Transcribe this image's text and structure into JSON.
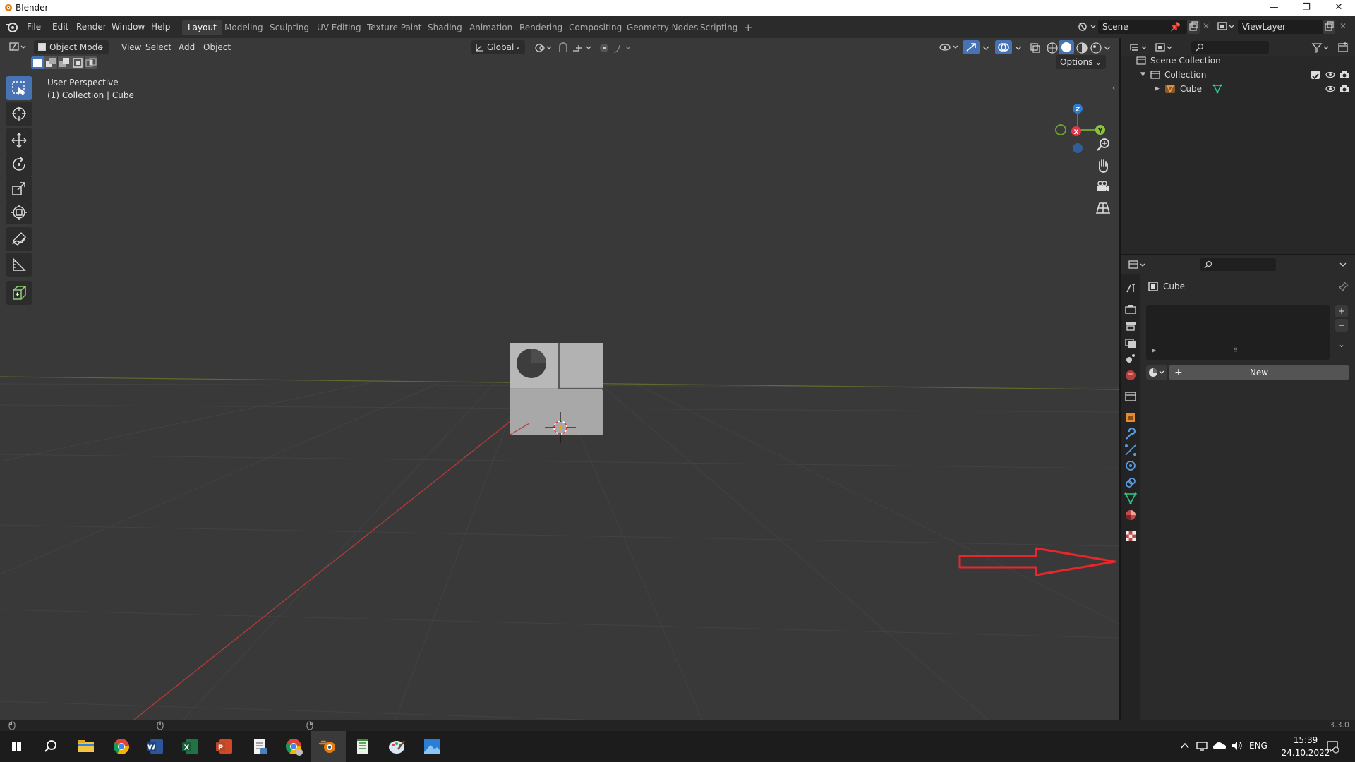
{
  "window": {
    "title": "Blender",
    "controls": [
      "—",
      "❐",
      "✕"
    ]
  },
  "menubar": [
    "File",
    "Edit",
    "Render",
    "Window",
    "Help"
  ],
  "workspaces": [
    {
      "label": "Layout",
      "active": true
    },
    {
      "label": "Modeling"
    },
    {
      "label": "Sculpting"
    },
    {
      "label": "UV Editing"
    },
    {
      "label": "Texture Paint"
    },
    {
      "label": "Shading"
    },
    {
      "label": "Animation"
    },
    {
      "label": "Rendering"
    },
    {
      "label": "Compositing"
    },
    {
      "label": "Geometry Nodes"
    },
    {
      "label": "Scripting"
    }
  ],
  "add_workspace": "+",
  "scene": {
    "label": "Scene",
    "view_layer": "ViewLayer"
  },
  "viewport": {
    "mode": "Object Mode",
    "menus": [
      "View",
      "Select",
      "Add",
      "Object"
    ],
    "orientation": "Global",
    "options": "Options",
    "overlay_line1": "User Perspective",
    "overlay_line2": "(1) Collection | Cube",
    "gizmo": {
      "z": "Z",
      "x": "X",
      "y": "Y"
    }
  },
  "outliner": {
    "rows": [
      {
        "label": "Scene Collection"
      },
      {
        "label": "Collection"
      },
      {
        "label": "Cube"
      }
    ]
  },
  "properties": {
    "object_name": "Cube",
    "new_button": "New"
  },
  "statusbar": {
    "version": "3.3.0"
  },
  "taskbar": {
    "language": "ENG",
    "time": "15:39",
    "date": "24.10.2022"
  },
  "colors": {
    "accent": "#4772b3",
    "annotation_arrow": "#e8262b",
    "viewport_bg": "#393939"
  }
}
